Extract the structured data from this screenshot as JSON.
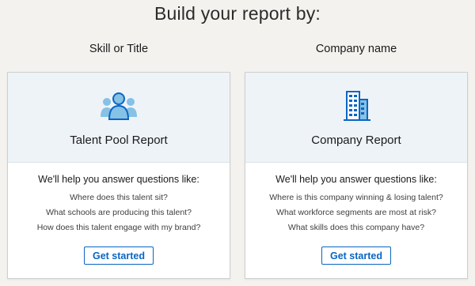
{
  "page_title": "Build your report by:",
  "columns": [
    {
      "heading": "Skill or Title",
      "icon": "people-group-icon",
      "card_title": "Talent Pool Report",
      "subtitle": "We'll help you answer questions like:",
      "questions": [
        "Where does this talent sit?",
        "What schools are producing this talent?",
        "How does this talent engage with my brand?"
      ],
      "button_label": "Get started"
    },
    {
      "heading": "Company name",
      "icon": "building-icon",
      "card_title": "Company Report",
      "subtitle": "We'll help you answer questions like:",
      "questions": [
        "Where is this company winning & losing talent?",
        "What workforce segments are most at risk?",
        "What skills does this company have?"
      ],
      "button_label": "Get started"
    }
  ],
  "colors": {
    "accent": "#0a66c2",
    "icon_dark": "#0a66c2",
    "icon_light": "#86c1e6",
    "card_header_bg": "#eef3f8",
    "page_bg": "#f3f2ef"
  }
}
